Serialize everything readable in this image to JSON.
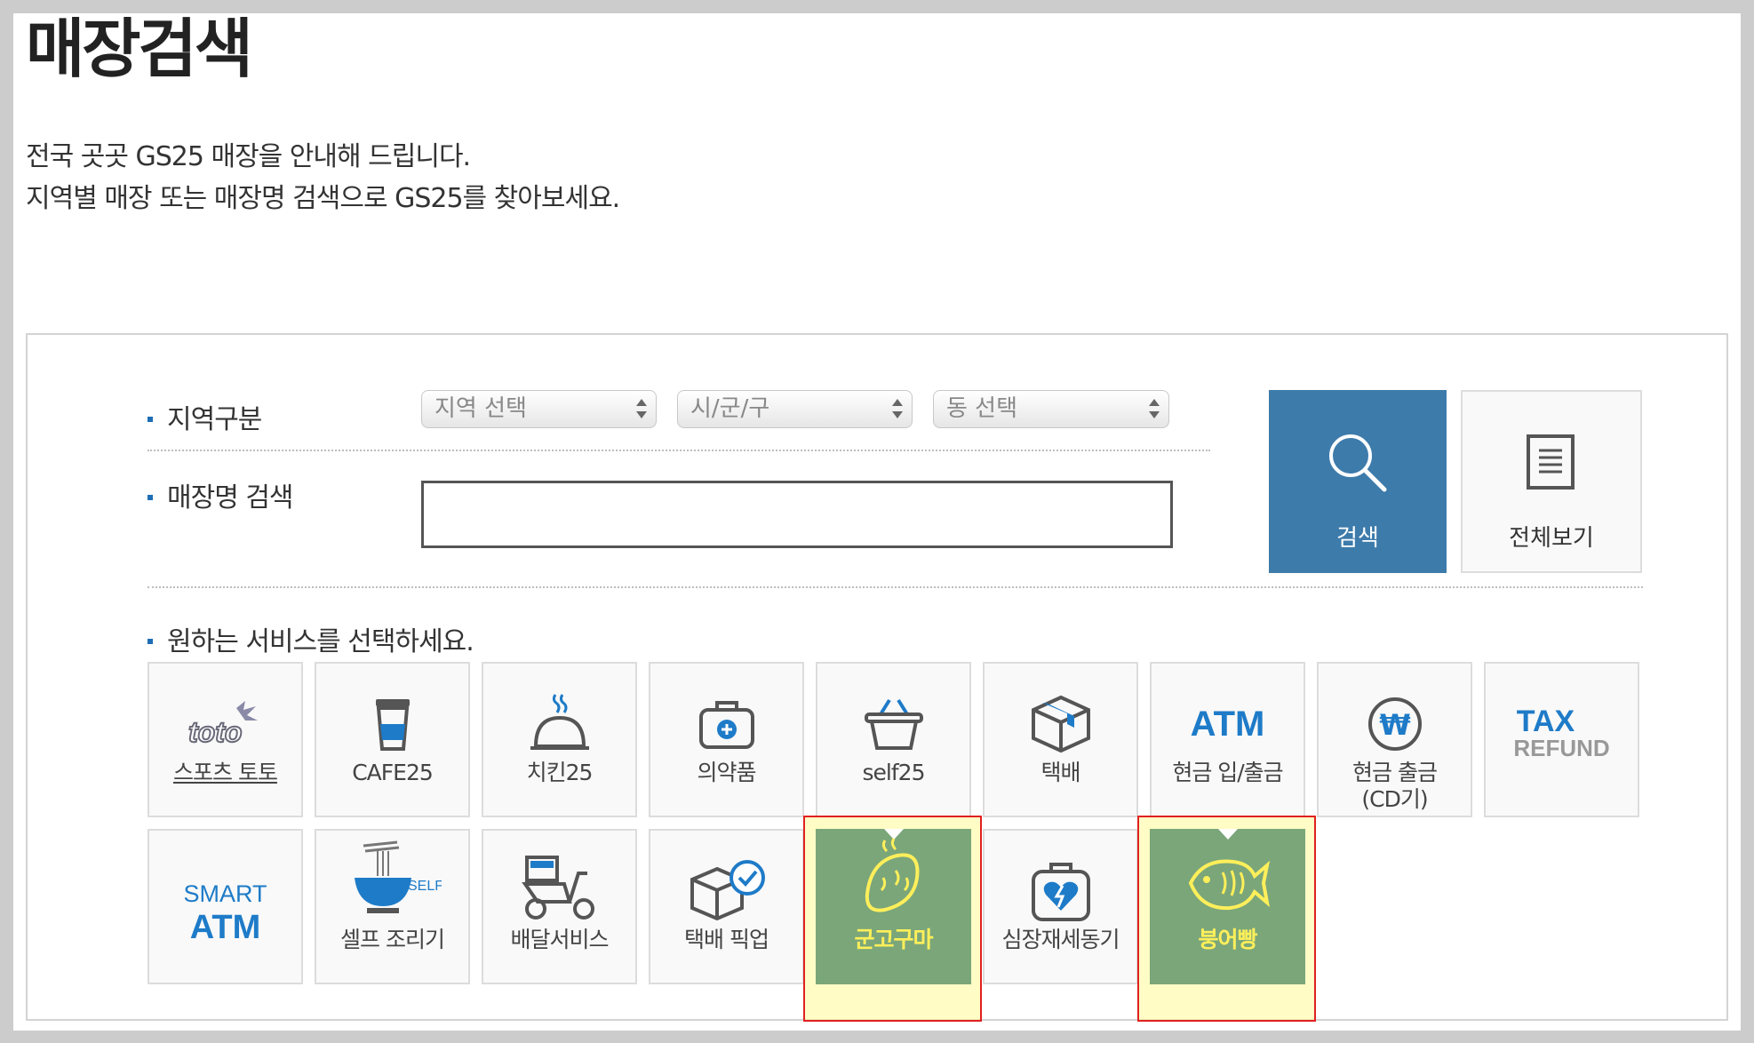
{
  "page": {
    "title": "매장검색",
    "intro_line1": "전국 곳곳 GS25 매장을 안내해 드립니다.",
    "intro_line2": "지역별 매장 또는 매장명 검색으로 GS25를 찾아보세요."
  },
  "search": {
    "region_label": "지역구분",
    "region_select": "지역 선택",
    "city_select": "시/군/구",
    "dong_select": "동 선택",
    "store_name_label": "매장명 검색",
    "store_name_value": "",
    "search_button": "검색",
    "view_all_button": "전체보기"
  },
  "services": {
    "label": "원하는 서비스를 선택하세요.",
    "row1": [
      {
        "label": "스포츠 토토",
        "icon": "toto-icon"
      },
      {
        "label": "CAFE25",
        "icon": "coffee-cup-icon"
      },
      {
        "label": "치킨25",
        "icon": "cloche-icon"
      },
      {
        "label": "의약품",
        "icon": "medicine-kit-icon"
      },
      {
        "label": "self25",
        "icon": "basket-icon"
      },
      {
        "label": "택배",
        "icon": "parcel-box-icon"
      },
      {
        "label": "현금 입/출금",
        "icon": "atm-text-icon"
      },
      {
        "label": "현금 출금\n(CD기)",
        "icon": "won-coin-icon"
      },
      {
        "label": "",
        "icon": "tax-refund-icon"
      }
    ],
    "row2": [
      {
        "label": "",
        "icon": "smart-atm-icon"
      },
      {
        "label": "셀프 조리기",
        "icon": "self-cooker-icon"
      },
      {
        "label": "배달서비스",
        "icon": "delivery-scooter-icon"
      },
      {
        "label": "택배 픽업",
        "icon": "parcel-pickup-icon"
      },
      {
        "label": "군고구마",
        "icon": "sweet-potato-icon"
      },
      {
        "label": "심장재세동기",
        "icon": "defibrillator-icon"
      },
      {
        "label": "붕어빵",
        "icon": "fish-bread-icon"
      }
    ],
    "icon_text": {
      "toto": "toto",
      "atm": "ATM",
      "won": "₩",
      "tax": "TAX",
      "refund": "REFUND",
      "smart": "SMART",
      "smart_atm": "ATM",
      "self": "SELF"
    }
  },
  "colors": {
    "accent_blue": "#3d7bab",
    "icon_blue": "#1e7bc8",
    "selected_green": "#7aa67a",
    "selected_label_yellow": "#ffef5a",
    "highlight_red": "#e02020"
  }
}
